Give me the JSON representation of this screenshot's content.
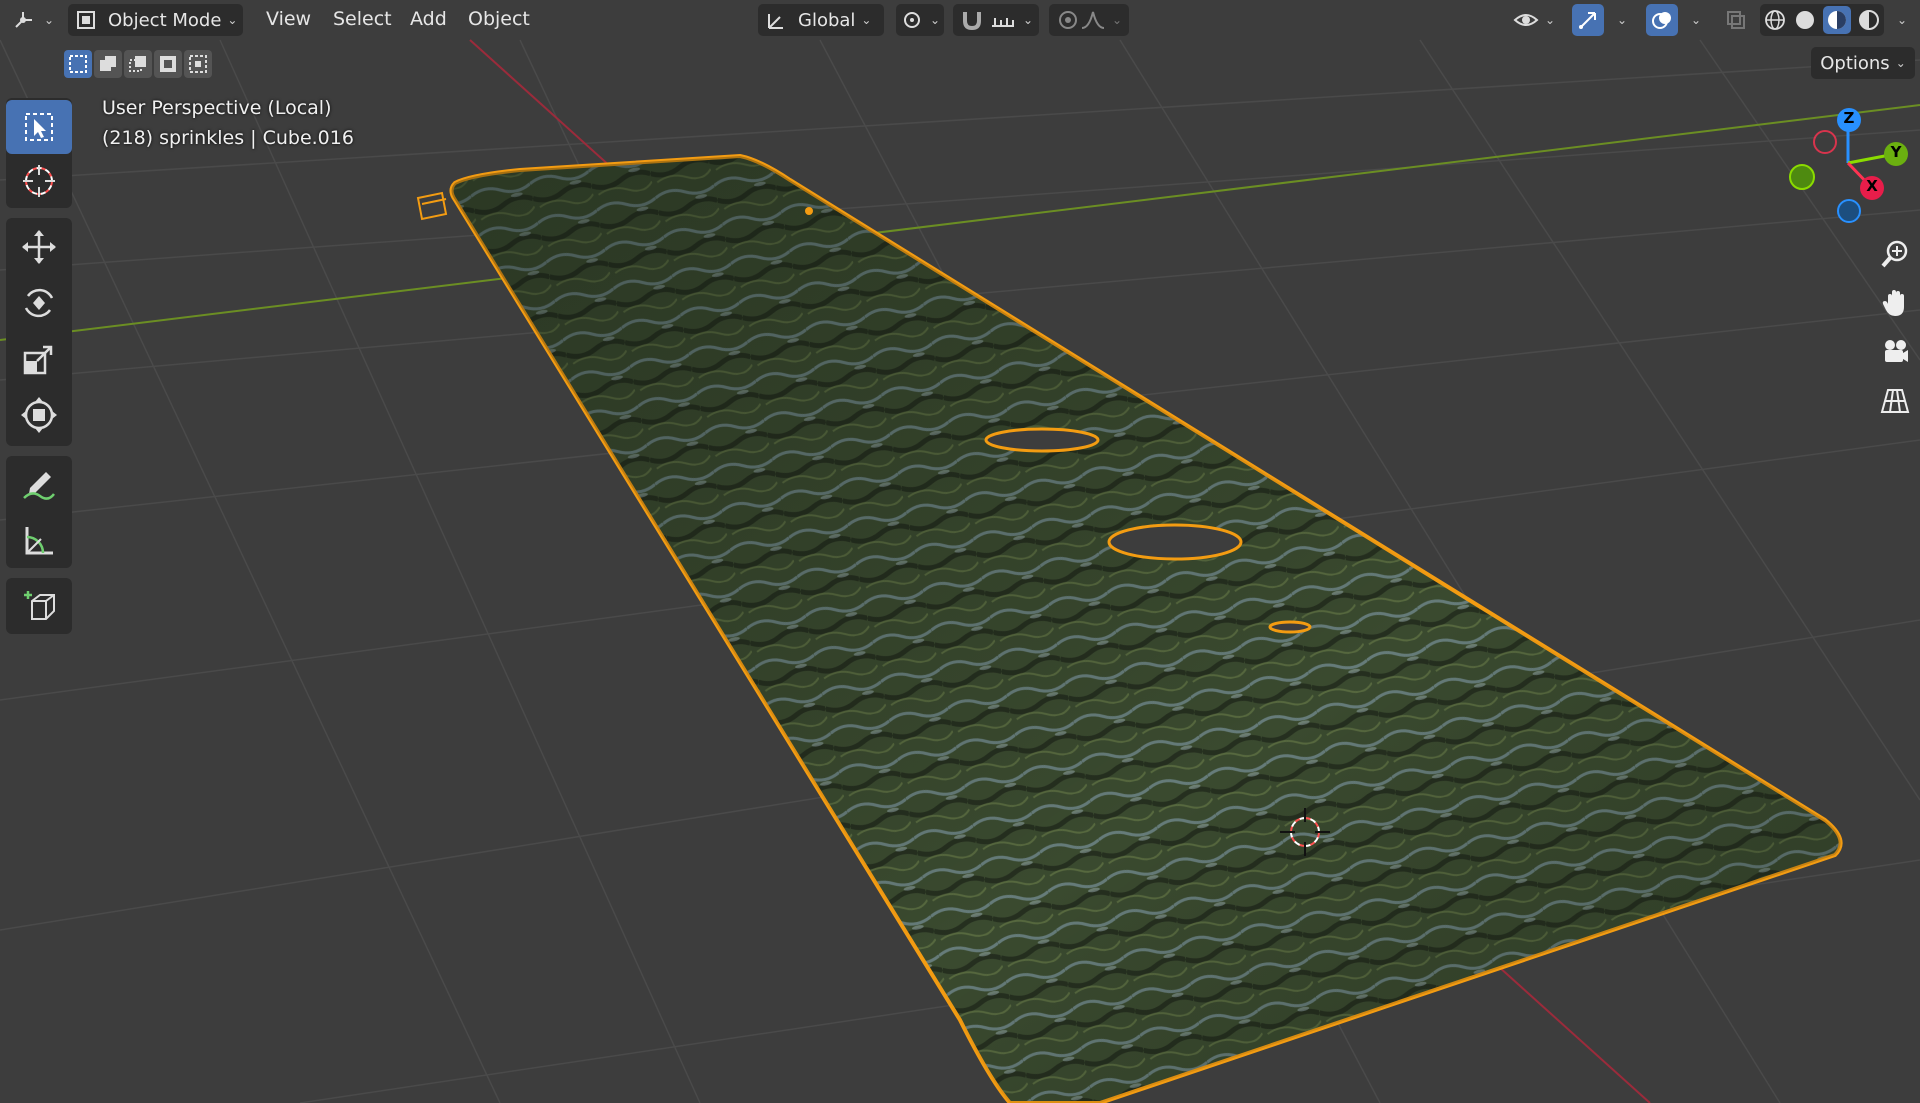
{
  "header": {
    "mode_label": "Object Mode",
    "menus": [
      "View",
      "Select",
      "Add",
      "Object"
    ],
    "transform_orientation": "Global",
    "options_label": "Options"
  },
  "viewport": {
    "perspective_label": "User Perspective (Local)",
    "object_label": "(218) sprinkles | Cube.016"
  },
  "gizmo": {
    "z_label": "Z",
    "y_label": "Y",
    "x_label": "X"
  },
  "toolbar": {
    "tools": [
      "select-box",
      "cursor",
      "move",
      "rotate",
      "scale",
      "transform",
      "annotate",
      "measure",
      "add-cube"
    ],
    "active": "select-box"
  },
  "colors": {
    "viewport_bg": "#3d3d3d",
    "header_bg": "#2c2c2c",
    "accent": "#4772b3",
    "selection_outline": "#f39c12",
    "x_axis": "#ff3352",
    "y_axis": "#8bdc00",
    "z_axis": "#2890ff"
  }
}
